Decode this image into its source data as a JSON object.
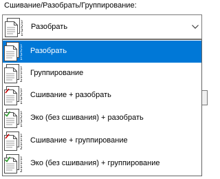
{
  "field_label": "Сшивание/Разобрать/Группирование:",
  "combo": {
    "selected_label": "Разобрать",
    "selected_icon": "collate-pages-icon"
  },
  "options": [
    {
      "label": "Разобрать",
      "icon": "collate-pages-icon",
      "selected": true
    },
    {
      "label": "Группирование",
      "icon": "group-pages-icon",
      "selected": false
    },
    {
      "label": "Сшивание + разобрать",
      "icon": "staple-collate-icon",
      "selected": false
    },
    {
      "label": "Эко (без сшивания) + разобрать",
      "icon": "eco-collate-icon",
      "selected": false
    },
    {
      "label": "Сшивание + группирование",
      "icon": "staple-group-icon",
      "selected": false
    },
    {
      "label": "Эко (без сшивания) + группирование",
      "icon": "eco-group-icon",
      "selected": false
    }
  ],
  "colors": {
    "selection": "#0078d7",
    "staple": "#cc0000",
    "eco": "#2e9a2e"
  }
}
